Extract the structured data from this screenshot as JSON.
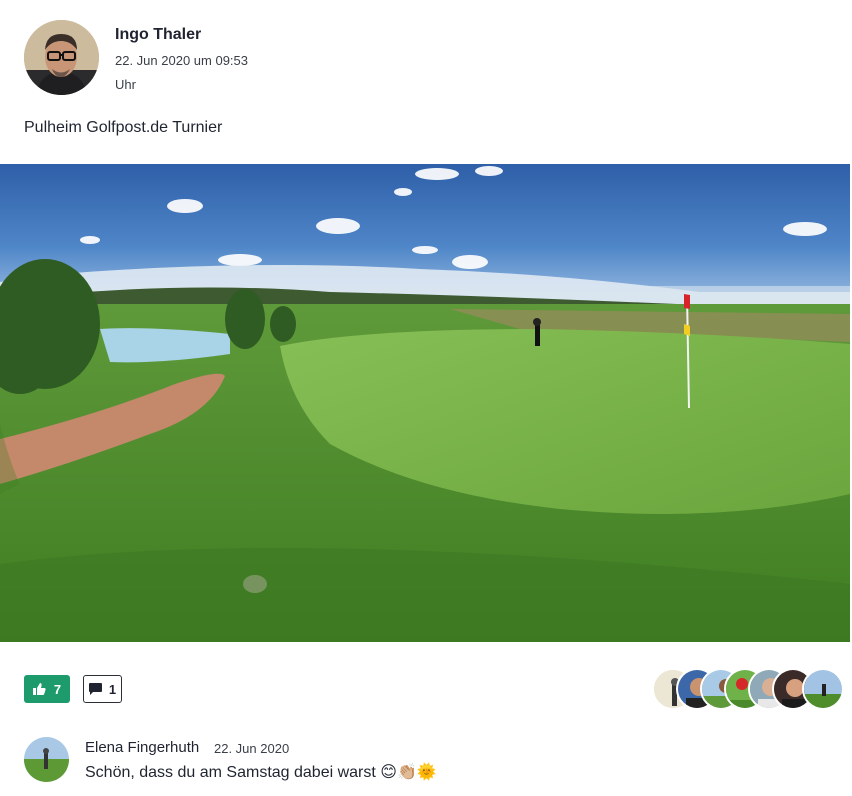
{
  "post": {
    "author": "Ingo Thaler",
    "date": "22. Jun 2020 um 09:53",
    "date_suffix": "Uhr",
    "text": "Pulheim Golfpost.de Turnier",
    "image_icon": "golf-course-photo"
  },
  "actions": {
    "like_icon": "thumbs-up-icon",
    "like_count": "7",
    "comment_icon": "speech-bubble-icon",
    "comment_count": "1",
    "accent_color": "#1e9b6c"
  },
  "likers": {
    "count_shown": 7
  },
  "comment": {
    "author": "Elena Fingerhuth",
    "date": "22. Jun 2020",
    "text": "Schön, dass du am Samstag dabei warst 😊👏🏼🌞"
  }
}
